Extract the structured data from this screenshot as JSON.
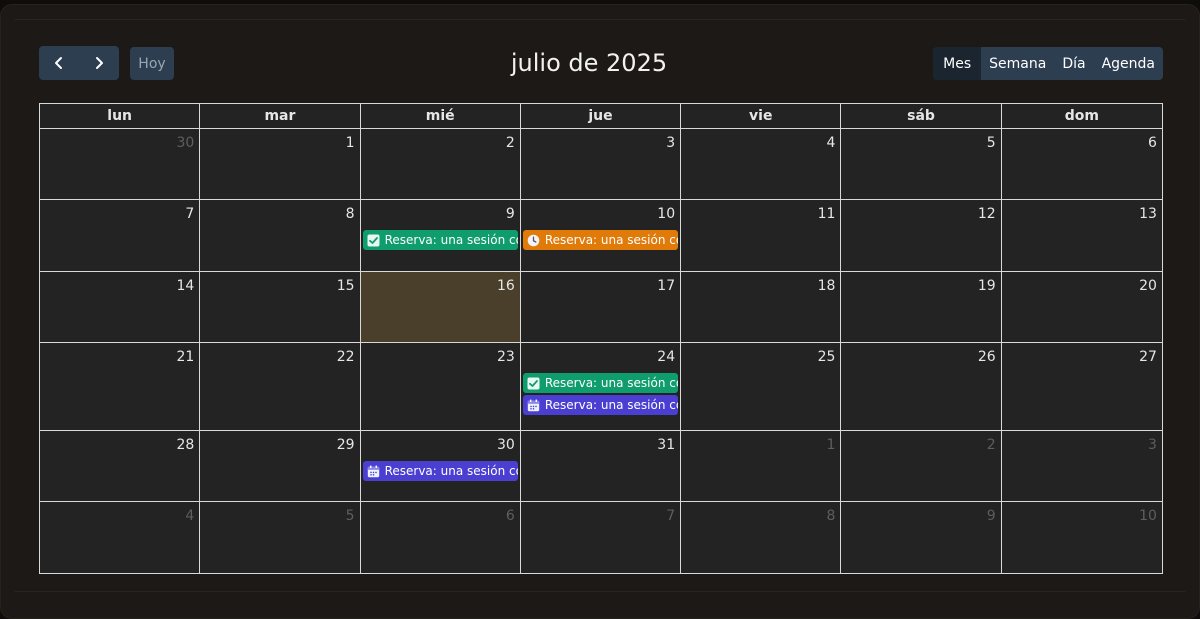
{
  "toolbar": {
    "title": "julio de 2025",
    "today_label": "Hoy",
    "views": [
      "Mes",
      "Semana",
      "Día",
      "Agenda"
    ],
    "active_view": "Mes"
  },
  "weekdays": [
    "lun",
    "mar",
    "mié",
    "jue",
    "vie",
    "sáb",
    "dom"
  ],
  "weeks": [
    [
      {
        "d": "30",
        "off": true
      },
      {
        "d": "1"
      },
      {
        "d": "2"
      },
      {
        "d": "3"
      },
      {
        "d": "4"
      },
      {
        "d": "5"
      },
      {
        "d": "6"
      }
    ],
    [
      {
        "d": "7"
      },
      {
        "d": "8"
      },
      {
        "d": "9"
      },
      {
        "d": "10"
      },
      {
        "d": "11"
      },
      {
        "d": "12"
      },
      {
        "d": "13"
      }
    ],
    [
      {
        "d": "14"
      },
      {
        "d": "15"
      },
      {
        "d": "16",
        "today": true
      },
      {
        "d": "17"
      },
      {
        "d": "18"
      },
      {
        "d": "19"
      },
      {
        "d": "20"
      }
    ],
    [
      {
        "d": "21"
      },
      {
        "d": "22"
      },
      {
        "d": "23"
      },
      {
        "d": "24"
      },
      {
        "d": "25"
      },
      {
        "d": "26"
      },
      {
        "d": "27"
      }
    ],
    [
      {
        "d": "28"
      },
      {
        "d": "29"
      },
      {
        "d": "30"
      },
      {
        "d": "31"
      },
      {
        "d": "1",
        "off": true
      },
      {
        "d": "2",
        "off": true
      },
      {
        "d": "3",
        "off": true
      }
    ],
    [
      {
        "d": "4",
        "off": true
      },
      {
        "d": "5",
        "off": true
      },
      {
        "d": "6",
        "off": true
      },
      {
        "d": "7",
        "off": true
      },
      {
        "d": "8",
        "off": true
      },
      {
        "d": "9",
        "off": true
      },
      {
        "d": "10",
        "off": true
      }
    ]
  ],
  "events": [
    {
      "week": 1,
      "day": 2,
      "slot": 0,
      "label": "Reserva: una sesión con tu",
      "status": "confirmed",
      "icon": "check-icon",
      "color": "#0f9d6e"
    },
    {
      "week": 1,
      "day": 3,
      "slot": 0,
      "label": "Reserva: una sesión con tu",
      "status": "pending",
      "icon": "clock-icon",
      "color": "#e07b0a"
    },
    {
      "week": 3,
      "day": 3,
      "slot": 0,
      "label": "Reserva: una sesión con tu",
      "status": "confirmed",
      "icon": "check-icon",
      "color": "#0f9d6e"
    },
    {
      "week": 3,
      "day": 3,
      "slot": 1,
      "label": "Reserva: una sesión con tu",
      "status": "scheduled",
      "icon": "calendar-icon",
      "color": "#4a3fd0"
    },
    {
      "week": 4,
      "day": 2,
      "slot": 0,
      "label": "Reserva: una sesión con tu",
      "status": "scheduled",
      "icon": "calendar-icon",
      "color": "#4a3fd0"
    }
  ],
  "colors": {
    "toolbar_button": "#2c3e50",
    "today_cell": "#4a3f2a",
    "grid_line": "#d9d9d9"
  }
}
